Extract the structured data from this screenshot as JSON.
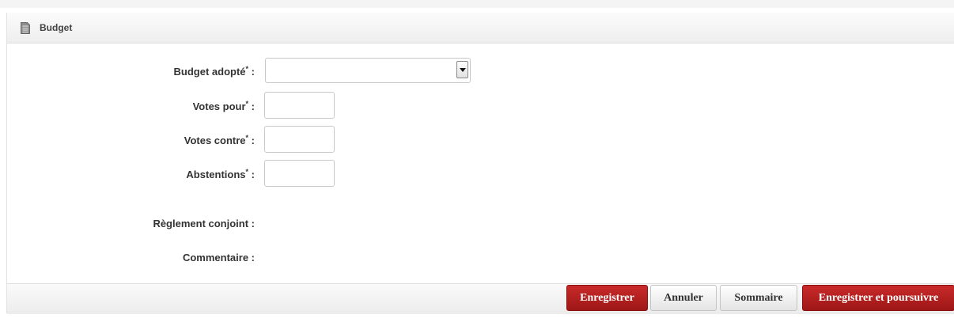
{
  "panel": {
    "title": "Budget",
    "icon": "document-icon"
  },
  "form": {
    "budget_adopte": {
      "label": "Budget adopté",
      "required_mark": "*",
      "suffix": " :",
      "value": ""
    },
    "votes_pour": {
      "label": "Votes pour",
      "required_mark": "*",
      "suffix": " :",
      "value": ""
    },
    "votes_contre": {
      "label": "Votes contre",
      "required_mark": "*",
      "suffix": " :",
      "value": ""
    },
    "abstentions": {
      "label": "Abstentions",
      "required_mark": "*",
      "suffix": " :",
      "value": ""
    },
    "reglement_conjoint": {
      "label": "Règlement conjoint :"
    },
    "commentaire": {
      "label": "Commentaire :"
    }
  },
  "actions": {
    "save_label": "Enregistrer",
    "cancel_label": "Annuler",
    "summary_label": "Sommaire",
    "save_continue_label": "Enregistrer et poursuivre"
  },
  "colors": {
    "primary_button": "#b01e1e",
    "header_bg": "#f2f2f2"
  }
}
